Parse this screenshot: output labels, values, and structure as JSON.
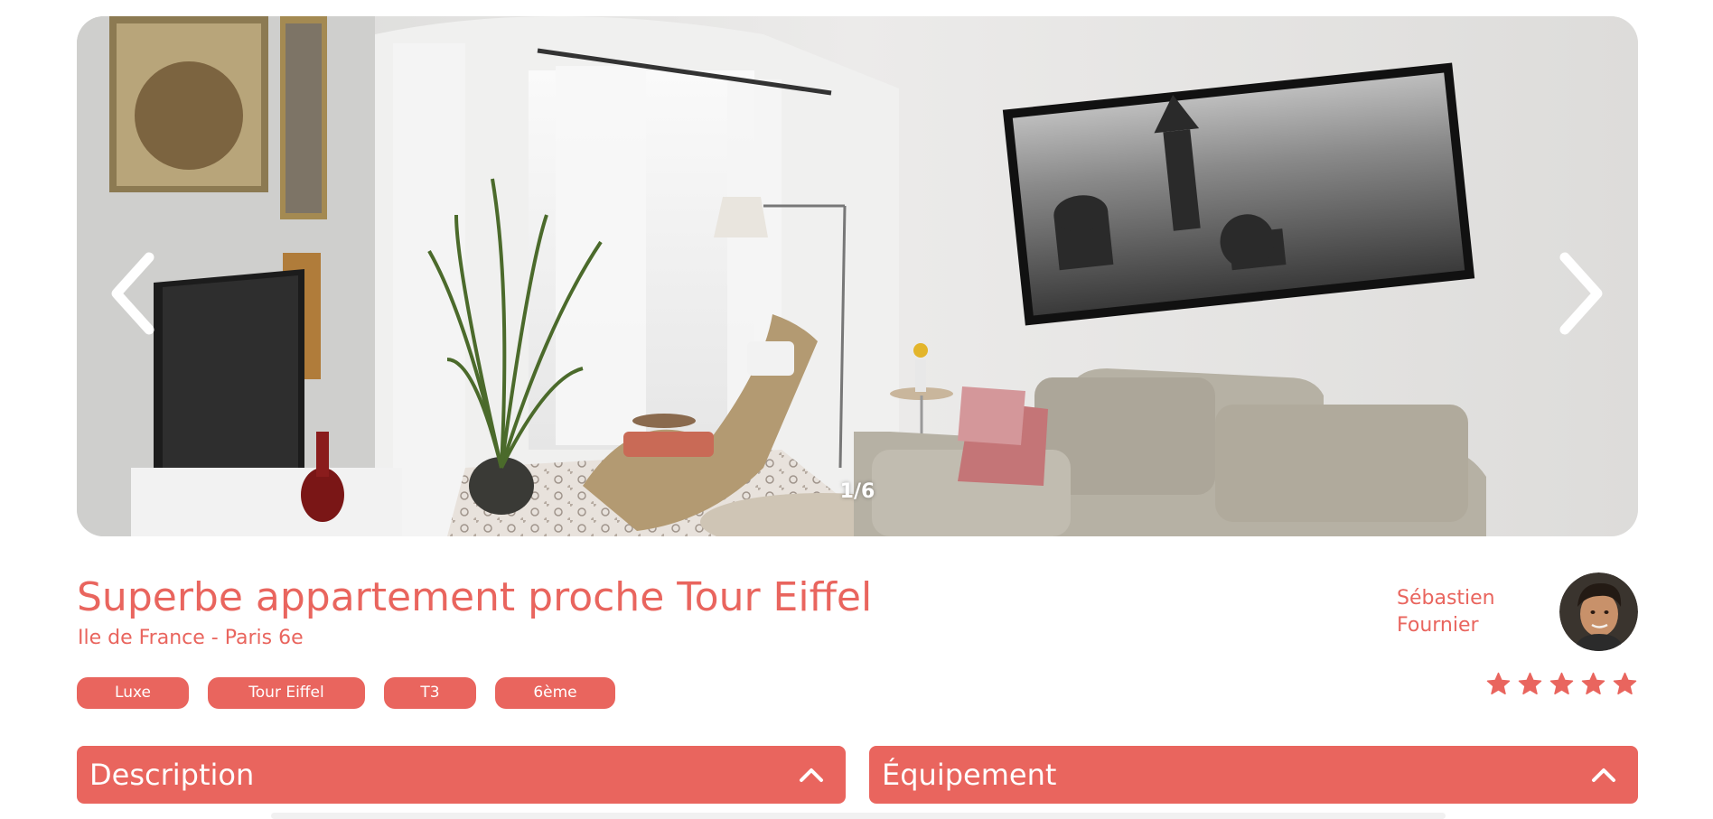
{
  "gallery": {
    "counter": "1/6",
    "prev_icon": "chevron-left-icon",
    "next_icon": "chevron-right-icon"
  },
  "listing": {
    "title": "Superbe appartement proche Tour Eiffel",
    "location": "Ile de France - Paris 6e",
    "tags": [
      "Luxe",
      "Tour Eiffel",
      "T3",
      "6ème"
    ]
  },
  "host": {
    "name": "Sébastien Fournier"
  },
  "rating": {
    "value": 5,
    "max": 5
  },
  "sections": {
    "description_label": "Description",
    "equipment_label": "Équipement"
  },
  "colors": {
    "accent": "#E9655E",
    "star_active": "#E9655E",
    "star_inactive": "#E3E3E3"
  }
}
